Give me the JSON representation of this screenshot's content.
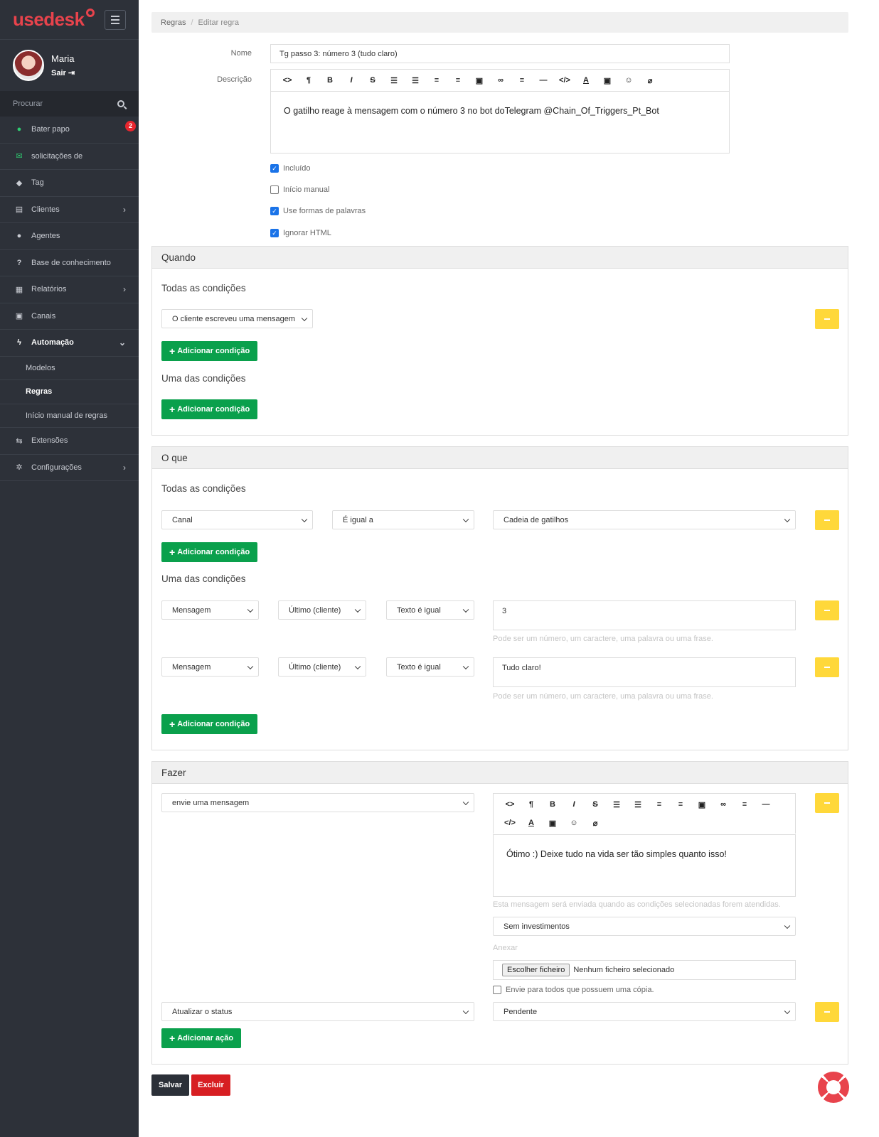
{
  "app": {
    "logo": "usedesk",
    "brand_color": "#e8434c"
  },
  "user": {
    "name": "Maria",
    "exit_label": "Sair"
  },
  "sidebar": {
    "search_placeholder": "Procurar",
    "items": [
      {
        "label": "Bater papo",
        "icon": "chat-icon",
        "badge": "2"
      },
      {
        "label": "solicitações de",
        "icon": "envelope-icon"
      },
      {
        "label": "Tag",
        "icon": "tag-icon"
      },
      {
        "label": "Clientes",
        "icon": "id-card-icon"
      },
      {
        "label": "Agentes",
        "icon": "user-icon"
      },
      {
        "label": "Base de conhecimento",
        "icon": "question-icon"
      },
      {
        "label": "Relatórios",
        "icon": "report-icon"
      },
      {
        "label": "Canais",
        "icon": "inbox-icon"
      },
      {
        "label": "Automação",
        "icon": "bolt-icon"
      },
      {
        "label": "Extensões",
        "icon": "exchange-icon"
      },
      {
        "label": "Configurações",
        "icon": "gear-icon"
      }
    ],
    "automation_sub": [
      "Modelos",
      "Regras",
      "Início manual de regras"
    ]
  },
  "breadcrumb": {
    "root": "Regras",
    "current": "Editar regra"
  },
  "form": {
    "name_label": "Nome",
    "name_value": "Tg passo 3: número 3 (tudo claro)",
    "desc_label": "Descrição",
    "desc_text": "O gatilho reage à mensagem com o número 3 no bot doTelegram @Chain_Of_Triggers_Pt_Bot",
    "checks": [
      {
        "label": "Incluído",
        "checked": true
      },
      {
        "label": "Início manual",
        "checked": false
      },
      {
        "label": "Use formas de palavras",
        "checked": true
      },
      {
        "label": "Ignorar HTML",
        "checked": true
      }
    ]
  },
  "when": {
    "title": "Quando",
    "all_label": "Todas as condições",
    "all_select": "O cliente escreveu uma mensagem",
    "any_label": "Uma das condições",
    "add_condition": "Adicionar condição"
  },
  "what": {
    "title": "O que",
    "all_label": "Todas as condições",
    "all_row": {
      "field": "Canal",
      "op": "É igual a",
      "value": "Cadeia de gatilhos"
    },
    "any_label": "Uma das condições",
    "any_rows": [
      {
        "field": "Mensagem",
        "which": "Último (cliente)",
        "op": "Texto é igual",
        "value": "3"
      },
      {
        "field": "Mensagem",
        "which": "Último (cliente)",
        "op": "Texto é igual",
        "value": "Tudo claro!"
      }
    ],
    "hint": "Pode ser um número, um caractere, uma palavra ou uma frase.",
    "add_condition": "Adicionar condição"
  },
  "do": {
    "title": "Fazer",
    "action1": "envie uma mensagem",
    "message": "Ótimo :) Deixe tudo na vida ser tão simples quanto isso!",
    "message_hint": "Esta mensagem será enviada quando as condições selecionadas forem atendidas.",
    "investment": "Sem investimentos",
    "attach_label": "Anexar",
    "file_button": "Escolher ficheiro",
    "file_status": "Nenhum ficheiro selecionado",
    "copy_check": "Envie para todos que possuem uma cópia.",
    "action2": "Atualizar o status",
    "status": "Pendente",
    "add_action": "Adicionar ação"
  },
  "footer": {
    "save": "Salvar",
    "delete": "Excluir"
  },
  "colors": {
    "green": "#0aa04c",
    "yellow": "#ffd83a",
    "sidebar": "#2d3139",
    "danger": "#d71e22"
  }
}
